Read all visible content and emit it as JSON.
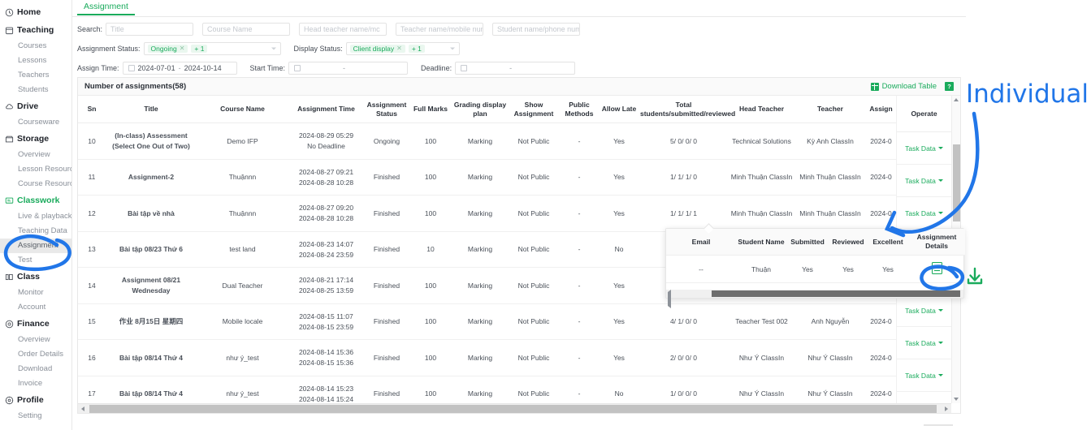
{
  "sidebar": {
    "groups": [
      {
        "label": "Home",
        "icon": "home-icon",
        "active": false,
        "items": []
      },
      {
        "label": "Teaching",
        "icon": "teaching-icon",
        "active": false,
        "items": [
          "Courses",
          "Lessons",
          "Teachers",
          "Students"
        ]
      },
      {
        "label": "Drive",
        "icon": "cloud-icon",
        "active": false,
        "items": [
          "Courseware"
        ]
      },
      {
        "label": "Storage",
        "icon": "storage-icon",
        "active": false,
        "items": [
          "Overview",
          "Lesson Resource",
          "Course Resource"
        ]
      },
      {
        "label": "Classwork",
        "icon": "classwork-icon",
        "active": true,
        "items": [
          "Live & playback",
          "Teaching Data",
          "Assignment",
          "Test"
        ]
      },
      {
        "label": "Class",
        "icon": "class-icon",
        "active": false,
        "items": [
          "Monitor",
          "Account"
        ]
      },
      {
        "label": "Finance",
        "icon": "finance-icon",
        "active": false,
        "items": [
          "Overview",
          "Order Details",
          "Download",
          "Invoice"
        ]
      },
      {
        "label": "Profile",
        "icon": "profile-icon",
        "active": false,
        "items": [
          "Setting"
        ]
      }
    ],
    "selected_item": "Assignment"
  },
  "tabs": [
    {
      "label": "Assignment",
      "active": true
    }
  ],
  "filters": {
    "search_label": "Search:",
    "search_inputs": [
      {
        "name": "title",
        "value": "",
        "placeholder": "Title"
      },
      {
        "name": "course-name",
        "value": "",
        "placeholder": "Course Name"
      },
      {
        "name": "head-teacher",
        "value": "",
        "placeholder": "Head teacher name/mc"
      },
      {
        "name": "teacher",
        "value": "",
        "placeholder": "Teacher name/mobile nun"
      },
      {
        "name": "student",
        "value": "",
        "placeholder": "Student name/phone num"
      }
    ],
    "assignment_status_label": "Assignment Status:",
    "assignment_status_tag": "Ongoing",
    "assignment_status_more": "+ 1",
    "display_status_label": "Display Status:",
    "display_status_tag": "Client display",
    "display_status_more": "+ 1",
    "assign_time_label": "Assign Time:",
    "assign_time_from": "2024-07-01",
    "assign_time_sep": "-",
    "assign_time_to": "2024-10-14",
    "start_time_label": "Start Time:",
    "start_time_value": "-",
    "deadline_label": "Deadline:",
    "deadline_value": "-"
  },
  "table_toolbar": {
    "count_label": "Number of assignments(58)",
    "download_label": "Download Table",
    "help_label": "?"
  },
  "table": {
    "columns": [
      "Sn",
      "Title",
      "Course Name",
      "Assignment Time",
      "Assignment Status",
      "Full Marks",
      "Grading display plan",
      "Show Assignment",
      "Public Methods",
      "Allow Late",
      "Total students/submitted/reviewed",
      "Head Teacher",
      "Teacher",
      "Assign",
      "Operate"
    ],
    "rows": [
      {
        "sn": "10",
        "title": "(In-class) Assessment (Select One Out of Two)",
        "course_name": "Demo IFP",
        "time_start": "2024-08-29 05:29",
        "time_end": "No Deadline",
        "status": "Ongoing",
        "full_marks": "100",
        "grading": "Marking",
        "show": "Not Public",
        "public_methods": "-",
        "allow_late": "Yes",
        "totals": "5/ 0/ 0/ 0",
        "head_teacher": "Technical Solutions",
        "teacher": "Kỳ Anh ClassIn",
        "assign": "2024-0",
        "operate": "Task Data"
      },
      {
        "sn": "11",
        "title": "Assignment-2",
        "course_name": "Thuậnnn",
        "time_start": "2024-08-27 09:21",
        "time_end": "2024-08-28 10:28",
        "status": "Finished",
        "full_marks": "100",
        "grading": "Marking",
        "show": "Not Public",
        "public_methods": "-",
        "allow_late": "Yes",
        "totals": "1/ 1/ 1/ 0",
        "head_teacher": "Minh Thuận ClassIn",
        "teacher": "Minh Thuận ClassIn",
        "assign": "2024-0",
        "operate": "Task Data"
      },
      {
        "sn": "12",
        "title": "Bài tập về nhà",
        "course_name": "Thuậnnn",
        "time_start": "2024-08-27 09:20",
        "time_end": "2024-08-28 10:28",
        "status": "Finished",
        "full_marks": "100",
        "grading": "Marking",
        "show": "Not Public",
        "public_methods": "-",
        "allow_late": "Yes",
        "totals": "1/ 1/ 1/ 1",
        "head_teacher": "Minh Thuận ClassIn",
        "teacher": "Minh Thuận ClassIn",
        "assign": "2024-0",
        "operate": "Task Data"
      },
      {
        "sn": "13",
        "title": "Bài tập 08/23 Thứ 6",
        "course_name": "test land",
        "time_start": "2024-08-23 14:07",
        "time_end": "2024-08-24 23:59",
        "status": "Finished",
        "full_marks": "10",
        "grading": "Marking",
        "show": "Not Public",
        "public_methods": "-",
        "allow_late": "No",
        "totals": "",
        "head_teacher": "",
        "teacher": "",
        "assign": "",
        "operate": ""
      },
      {
        "sn": "14",
        "title": "Assignment 08/21 Wednesday",
        "course_name": "Dual Teacher",
        "time_start": "2024-08-21 17:14",
        "time_end": "2024-08-25 13:59",
        "status": "Finished",
        "full_marks": "100",
        "grading": "Marking",
        "show": "Not Public",
        "public_methods": "-",
        "allow_late": "Yes",
        "totals": "",
        "head_teacher": "",
        "teacher": "",
        "assign": "",
        "operate": ""
      },
      {
        "sn": "15",
        "title": "作业 8月15日 星期四",
        "course_name": "Mobile locale",
        "time_start": "2024-08-15 11:07",
        "time_end": "2024-08-15 23:59",
        "status": "Finished",
        "full_marks": "100",
        "grading": "Marking",
        "show": "Not Public",
        "public_methods": "-",
        "allow_late": "Yes",
        "totals": "4/ 1/ 0/ 0",
        "head_teacher": "Teacher Test 002",
        "teacher": "Anh Nguyễn",
        "assign": "2024-0",
        "operate": "Task Data"
      },
      {
        "sn": "16",
        "title": "Bài tập 08/14 Thứ 4",
        "course_name": "như ý_test",
        "time_start": "2024-08-14 15:36",
        "time_end": "2024-08-15 15:36",
        "status": "Finished",
        "full_marks": "100",
        "grading": "Marking",
        "show": "Not Public",
        "public_methods": "-",
        "allow_late": "Yes",
        "totals": "2/ 0/ 0/ 0",
        "head_teacher": "Như Ý ClassIn",
        "teacher": "Như Ý ClassIn",
        "assign": "2024-0",
        "operate": "Task Data"
      },
      {
        "sn": "17",
        "title": "Bài tập 08/14 Thứ 4",
        "course_name": "như ý_test",
        "time_start": "2024-08-14 15:23",
        "time_end": "2024-08-14 15:24",
        "status": "Finished",
        "full_marks": "100",
        "grading": "Marking",
        "show": "Not Public",
        "public_methods": "-",
        "allow_late": "No",
        "totals": "1/ 0/ 0/ 0",
        "head_teacher": "Như Ý ClassIn",
        "teacher": "Như Ý ClassIn",
        "assign": "2024-0",
        "operate": "Task Data"
      }
    ]
  },
  "popup": {
    "columns": [
      "Email",
      "Student Name",
      "Submitted",
      "Reviewed",
      "Excellent",
      "Assignment Details"
    ],
    "rows": [
      {
        "email": "--",
        "student_name": "Thuận",
        "submitted": "Yes",
        "reviewed": "Yes",
        "excellent": "Yes",
        "details_icon": "assignment-details-icon"
      }
    ]
  },
  "annotations": {
    "label": "Individual",
    "label_color": "#2176e8",
    "circle_color": "#2176e8",
    "download_icon_color": "#1aab5c"
  },
  "theme": {
    "accent_green": "#1aab5c",
    "annotation_blue": "#2176e8",
    "text_dark": "#2b3038",
    "text_muted": "#8a9099",
    "border": "#e8e8e8"
  }
}
